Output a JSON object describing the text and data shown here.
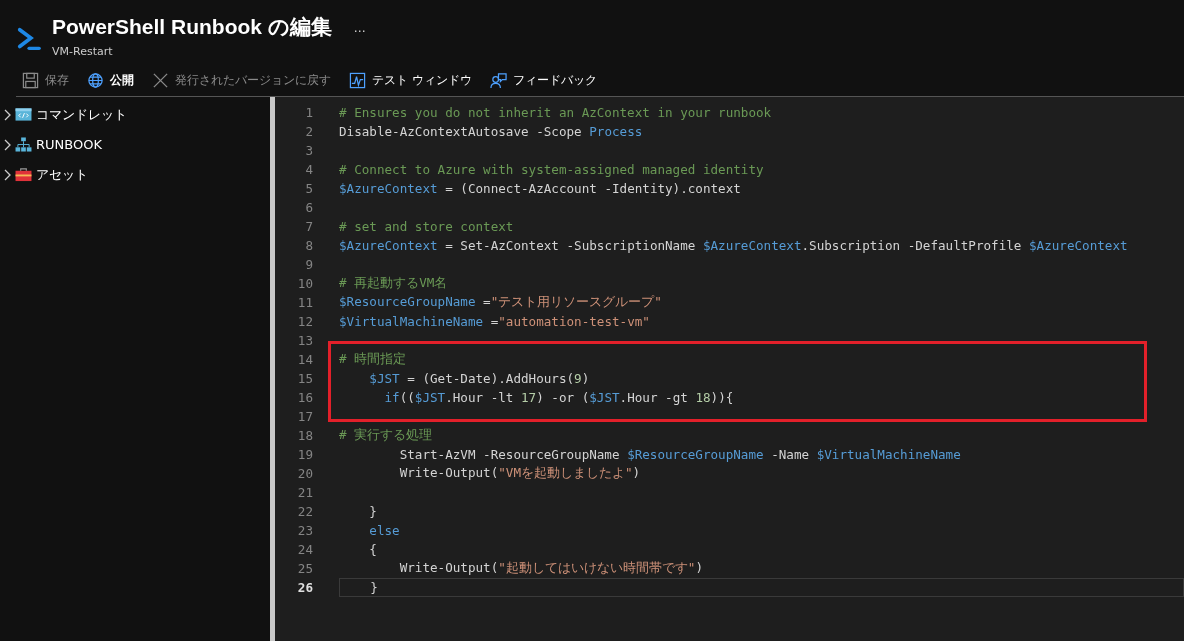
{
  "header": {
    "title": "PowerShell Runbook の編集",
    "subtitle": "VM-Restart",
    "more": "..."
  },
  "toolbar": [
    {
      "kind": "save",
      "label": "保存",
      "disabled": true
    },
    {
      "kind": "publish",
      "label": "公開",
      "disabled": false
    },
    {
      "kind": "revert",
      "label": "発行されたバージョンに戻す",
      "disabled": true
    },
    {
      "kind": "test",
      "label": "テスト ウィンドウ",
      "disabled": false
    },
    {
      "kind": "feedback",
      "label": "フィードバック",
      "disabled": false
    }
  ],
  "sidebar": {
    "items": [
      {
        "kind": "cmdlet",
        "label": "コマンドレット",
        "expanded": false
      },
      {
        "kind": "runbook",
        "label": "RUNBOOK",
        "expanded": false
      },
      {
        "kind": "asset",
        "label": "アセット",
        "expanded": false
      }
    ]
  },
  "editor": {
    "lines": [
      {
        "number": "1",
        "current": false,
        "highlighted": false,
        "tokens": [
          {
            "kind": "comment",
            "text": "# Ensures you do not inherit an AzContext in your runbook"
          }
        ]
      },
      {
        "number": "2",
        "current": false,
        "highlighted": false,
        "tokens": [
          {
            "kind": "plain",
            "text": "Disable-AzContextAutosave -Scope "
          },
          {
            "kind": "keyword",
            "text": "Process"
          }
        ]
      },
      {
        "number": "3",
        "current": false,
        "highlighted": false
      },
      {
        "number": "4",
        "current": false,
        "highlighted": false,
        "tokens": [
          {
            "kind": "comment",
            "text": "# Connect to Azure with system-assigned managed identity"
          }
        ]
      },
      {
        "number": "5",
        "current": false,
        "highlighted": false,
        "tokens": [
          {
            "kind": "variable",
            "text": "$AzureContext"
          },
          {
            "kind": "plain",
            "text": " = (Connect-AzAccount -Identity).context"
          }
        ]
      },
      {
        "number": "6",
        "current": false,
        "highlighted": false
      },
      {
        "number": "7",
        "current": false,
        "highlighted": false,
        "tokens": [
          {
            "kind": "comment",
            "text": "# set and store context"
          }
        ]
      },
      {
        "number": "8",
        "current": false,
        "highlighted": false,
        "tokens": [
          {
            "kind": "variable",
            "text": "$AzureContext"
          },
          {
            "kind": "plain",
            "text": " = Set-AzContext -SubscriptionName "
          },
          {
            "kind": "variable",
            "text": "$AzureContext"
          },
          {
            "kind": "plain",
            "text": ".Subscription -DefaultProfile "
          },
          {
            "kind": "variable",
            "text": "$AzureContext"
          }
        ]
      },
      {
        "number": "9",
        "current": false,
        "highlighted": false
      },
      {
        "number": "10",
        "current": false,
        "highlighted": false,
        "tokens": [
          {
            "kind": "comment",
            "text": "# 再起動するVM名"
          }
        ]
      },
      {
        "number": "11",
        "current": false,
        "highlighted": false,
        "tokens": [
          {
            "kind": "variable",
            "text": "$ResourceGroupName"
          },
          {
            "kind": "plain",
            "text": " ="
          },
          {
            "kind": "string",
            "text": "\"テスト用リソースグループ\""
          }
        ]
      },
      {
        "number": "12",
        "current": false,
        "highlighted": false,
        "tokens": [
          {
            "kind": "variable",
            "text": "$VirtualMachineName"
          },
          {
            "kind": "plain",
            "text": " ="
          },
          {
            "kind": "string",
            "text": "\"automation-test-vm\""
          }
        ]
      },
      {
        "number": "13",
        "current": false,
        "highlighted": false
      },
      {
        "number": "14",
        "current": false,
        "highlighted": true,
        "tokens": [
          {
            "kind": "comment",
            "text": "# 時間指定"
          }
        ]
      },
      {
        "number": "15",
        "current": false,
        "highlighted": true,
        "tokens": [
          {
            "kind": "variable",
            "text": "    $JST"
          },
          {
            "kind": "plain",
            "text": " = (Get-Date).AddHours("
          },
          {
            "kind": "number",
            "text": "9"
          },
          {
            "kind": "plain",
            "text": ")"
          }
        ]
      },
      {
        "number": "16",
        "current": false,
        "highlighted": true,
        "tokens": [
          {
            "kind": "keyword",
            "text": "      if"
          },
          {
            "kind": "plain",
            "text": "(("
          },
          {
            "kind": "variable",
            "text": "$JST"
          },
          {
            "kind": "plain",
            "text": ".Hour -lt "
          },
          {
            "kind": "number",
            "text": "17"
          },
          {
            "kind": "plain",
            "text": ") -or ("
          },
          {
            "kind": "variable",
            "text": "$JST"
          },
          {
            "kind": "plain",
            "text": ".Hour -gt "
          },
          {
            "kind": "number",
            "text": "18"
          },
          {
            "kind": "plain",
            "text": ")){"
          }
        ]
      },
      {
        "number": "17",
        "current": false,
        "highlighted": true
      },
      {
        "number": "18",
        "current": false,
        "highlighted": false,
        "tokens": [
          {
            "kind": "comment",
            "text": "# 実行する処理"
          }
        ]
      },
      {
        "number": "19",
        "current": false,
        "highlighted": false,
        "tokens": [
          {
            "kind": "plain",
            "text": "        Start-AzVM -ResourceGroupName "
          },
          {
            "kind": "variable",
            "text": "$ResourceGroupName"
          },
          {
            "kind": "plain",
            "text": " -Name "
          },
          {
            "kind": "variable",
            "text": "$VirtualMachineName"
          }
        ]
      },
      {
        "number": "20",
        "current": false,
        "highlighted": false,
        "tokens": [
          {
            "kind": "plain",
            "text": "        Write-Output("
          },
          {
            "kind": "string",
            "text": "\"VMを起動しましたよ\""
          },
          {
            "kind": "plain",
            "text": ")"
          }
        ]
      },
      {
        "number": "21",
        "current": false,
        "highlighted": false
      },
      {
        "number": "22",
        "current": false,
        "highlighted": false,
        "tokens": [
          {
            "kind": "plain",
            "text": "    }"
          }
        ]
      },
      {
        "number": "23",
        "current": false,
        "highlighted": false,
        "tokens": [
          {
            "kind": "keyword",
            "text": "    else"
          }
        ]
      },
      {
        "number": "24",
        "current": false,
        "highlighted": false,
        "tokens": [
          {
            "kind": "plain",
            "text": "    {"
          }
        ]
      },
      {
        "number": "25",
        "current": false,
        "highlighted": false,
        "tokens": [
          {
            "kind": "plain",
            "text": "        Write-Output("
          },
          {
            "kind": "string",
            "text": "\"起動してはいけない時間帯です\""
          },
          {
            "kind": "plain",
            "text": ")"
          }
        ]
      },
      {
        "number": "26",
        "current": true,
        "highlighted": false,
        "tokens": [
          {
            "kind": "plain",
            "text": "    }"
          }
        ]
      }
    ]
  }
}
